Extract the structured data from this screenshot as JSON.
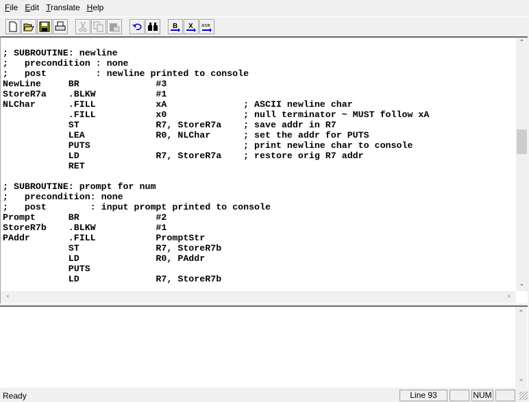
{
  "menu": [
    "File",
    "Edit",
    "Translate",
    "Help"
  ],
  "toolbar": [
    {
      "icon": "new-file-icon",
      "enabled": true
    },
    {
      "icon": "open-folder-icon",
      "enabled": true
    },
    {
      "icon": "save-icon",
      "enabled": true
    },
    {
      "icon": "print-icon",
      "enabled": true
    },
    {
      "icon": "cut-icon",
      "enabled": false
    },
    {
      "icon": "copy-icon",
      "enabled": false
    },
    {
      "icon": "paste-icon",
      "enabled": false
    },
    {
      "icon": "undo-icon",
      "enabled": true
    },
    {
      "icon": "find-binoculars-icon",
      "enabled": true
    },
    {
      "icon": "binary-convert-icon",
      "label": "B",
      "enabled": true
    },
    {
      "icon": "hex-convert-icon",
      "label": "X",
      "enabled": true
    },
    {
      "icon": "assemble-icon",
      "label": "asm",
      "enabled": true
    }
  ],
  "code": [
    "; SUBROUTINE: newline",
    ";   precondition : none",
    ";   post         : newline printed to console",
    "NewLine     BR              #3",
    "StoreR7a    .BLKW           #1",
    "NLChar      .FILL           xA              ; ASCII newline char",
    "            .FILL           x0              ; null terminator ~ MUST follow xA",
    "            ST              R7, StoreR7a    ; save addr in R7",
    "            LEA             R0, NLChar      ; set the addr for PUTS",
    "            PUTS                            ; print newline char to console",
    "            LD              R7, StoreR7a    ; restore orig R7 addr",
    "            RET",
    "",
    "; SUBROUTINE: prompt for num",
    ";   precondition: none",
    ";   post        : input prompt printed to console",
    "Prompt      BR              #2",
    "StoreR7b    .BLKW           #1",
    "PAddr       .FILL           PromptStr",
    "            ST              R7, StoreR7b",
    "            LD              R0, PAddr",
    "            PUTS",
    "            LD              R7, StoreR7b"
  ],
  "status": {
    "text": "Ready",
    "line": "Line 93",
    "num": "NUM"
  }
}
